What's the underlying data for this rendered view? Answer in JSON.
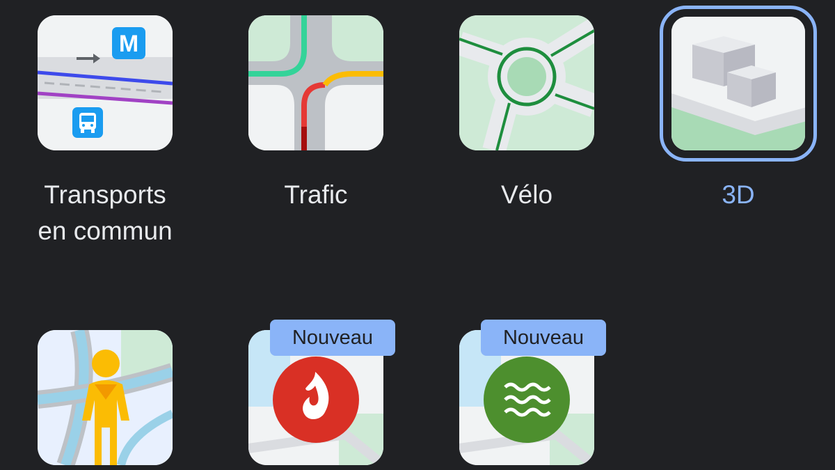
{
  "layers": [
    {
      "id": "transit",
      "label": "Transports\nen commun",
      "selected": false,
      "icon": "transit-map-icon"
    },
    {
      "id": "traffic",
      "label": "Trafic",
      "selected": false,
      "icon": "traffic-map-icon"
    },
    {
      "id": "bike",
      "label": "Vélo",
      "selected": false,
      "icon": "bike-map-icon"
    },
    {
      "id": "3d",
      "label": "3D",
      "selected": true,
      "icon": "3d-buildings-icon"
    },
    {
      "id": "street-view",
      "label": "",
      "selected": false,
      "icon": "street-view-pegman-icon"
    },
    {
      "id": "wildfires",
      "label": "",
      "selected": false,
      "badge": "Nouveau",
      "icon": "wildfire-flame-icon"
    },
    {
      "id": "air-quality",
      "label": "",
      "selected": false,
      "badge": "Nouveau",
      "icon": "air-quality-waves-icon"
    }
  ],
  "colors": {
    "background": "#202124",
    "label_text": "#e8eaed",
    "selected_accent": "#8ab4f8",
    "badge_background": "#8ab4f8"
  }
}
